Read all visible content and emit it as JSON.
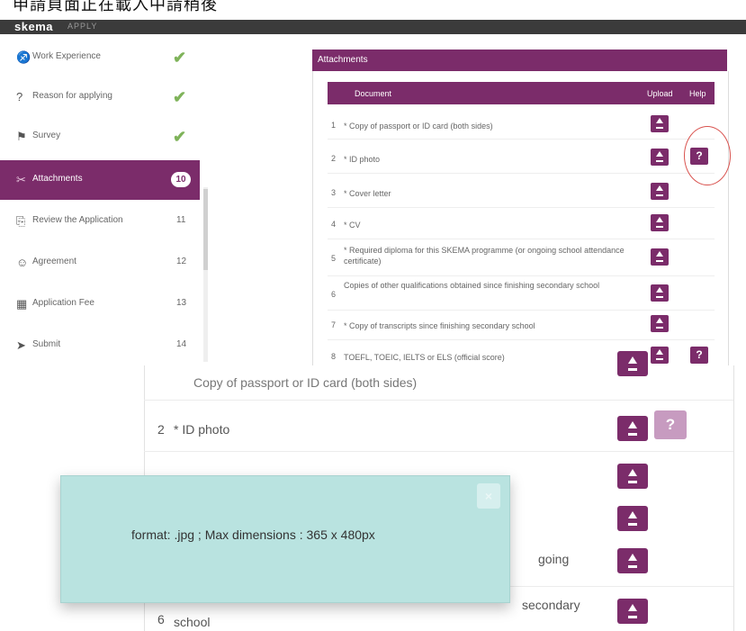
{
  "top_strip_text": "申請頁面正在載入中請稍後",
  "header": {
    "logo": "skema",
    "apply": "APPLY"
  },
  "sidebar": {
    "items": [
      {
        "label": "Work Experience",
        "icon": "briefcase-icon",
        "glyph": "♐",
        "status": "check"
      },
      {
        "label": "Reason for applying",
        "icon": "question-icon",
        "glyph": "?",
        "status": "check"
      },
      {
        "label": "Survey",
        "icon": "signpost-icon",
        "glyph": "⚑",
        "status": "check"
      },
      {
        "label": "Attachments",
        "icon": "paperclip-icon",
        "glyph": "✂",
        "badge": "10"
      },
      {
        "label": "Review the Application",
        "icon": "document-icon",
        "glyph": "⎘",
        "num": "11"
      },
      {
        "label": "Agreement",
        "icon": "people-icon",
        "glyph": "☺",
        "num": "12"
      },
      {
        "label": "Application Fee",
        "icon": "table-icon",
        "glyph": "▦",
        "num": "13"
      },
      {
        "label": "Submit",
        "icon": "send-icon",
        "glyph": "➤",
        "num": "14"
      }
    ]
  },
  "attachments": {
    "title": "Attachments",
    "columns": {
      "document": "Document",
      "upload": "Upload",
      "help": "Help"
    },
    "rows": [
      {
        "n": "1",
        "text": "* Copy of passport or ID card (both sides)"
      },
      {
        "n": "2",
        "text": "* ID photo"
      },
      {
        "n": "3",
        "text": "* Cover letter"
      },
      {
        "n": "4",
        "text": "* CV"
      },
      {
        "n": "5",
        "text": "* Required diploma for this SKEMA programme (or ongoing school attendance certificate)"
      },
      {
        "n": "6",
        "text": "Copies of other qualifications obtained since finishing secondary school"
      },
      {
        "n": "7",
        "text": "* Copy of transcripts since finishing secondary school"
      },
      {
        "n": "8",
        "text": "TOEFL, TOEIC, IELTS or ELS (official score)"
      }
    ],
    "help_label": "?"
  },
  "zoom": {
    "row1_partial": "Copy of passport or ID card (both sides)",
    "row2_num": "2",
    "row2_text": "* ID photo",
    "row5_tail": "going",
    "row6_num": "6",
    "row6_tail": "secondary",
    "row6_line2": "school",
    "help_label": "?"
  },
  "tooltip": {
    "message": "format: .jpg ; Max dimensions : 365 x 480px",
    "close_label": "×"
  },
  "colors": {
    "brand": "#7b2c6a",
    "check": "#7fb35a",
    "tooltip_bg": "#b9e3e0",
    "highlight": "#d9534f"
  }
}
